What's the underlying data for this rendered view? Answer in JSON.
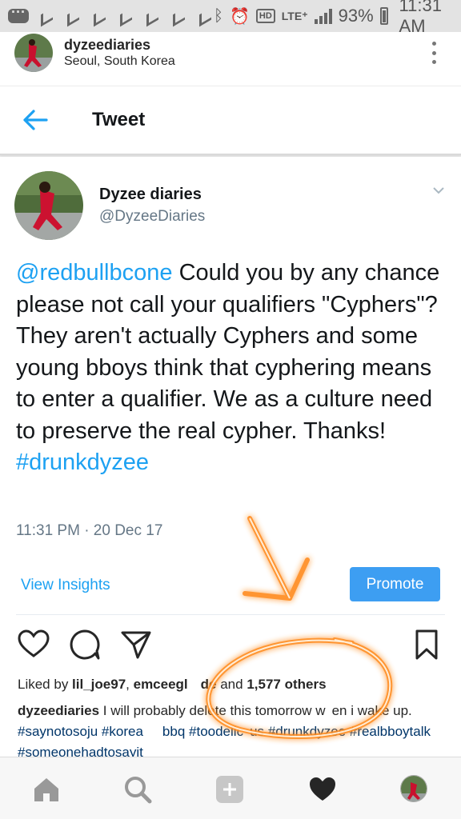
{
  "status_bar": {
    "battery": "93%",
    "time": "11:31 AM",
    "network": "LTE⁺",
    "hd": "HD",
    "icons": [
      "message-icon",
      "notification-icon",
      "notification-icon",
      "notification-icon",
      "notification-icon",
      "notification-icon",
      "notification-icon",
      "notification-icon",
      "bluetooth-icon",
      "alarm-icon",
      "hd-icon",
      "lte-icon",
      "signal-icon",
      "battery-icon"
    ]
  },
  "post_header": {
    "username": "dyzeediaries",
    "location": "Seoul, South Korea"
  },
  "tweet": {
    "screen_title": "Tweet",
    "display_name": "Dyzee diaries",
    "handle": "@DyzeeDiaries",
    "mention": "@redbullbcone",
    "body": " Could you by any chance please not call your qualifiers \"Cyphers\"? They aren't actually Cyphers and some young bboys think that cyphering means to enter a qualifier. We as a culture need to preserve the real cypher. Thanks! ",
    "hashtag": "#drunkdyzee",
    "timestamp": "11:31 PM · 20 Dec 17",
    "insights_label": "View Insights",
    "promote_label": "Promote",
    "link_color": "#1da1f2"
  },
  "post": {
    "liked_by_prefix": "Liked by ",
    "liker1": "lil_joe97",
    "sep": ", ",
    "liker2": "emceegl",
    "liker2_end": "de",
    "and_text": " and ",
    "others": "1,577 others",
    "caption_user": "dyzeediaries",
    "caption_text1": " I will probably delete this tomorrow w",
    "caption_text2": "en i wake up. ",
    "tag1": "#saynotosoju",
    "tag2": "#korea",
    "tag2_end": "bbq",
    "tag3": "#toodelic",
    "tag3_end": "us",
    "tag4": "#drunkdyzee",
    "tag5": "#realbboytalk",
    "tag6": "#someonehadtosayit"
  },
  "overlay": {
    "doodle_color": "#ff8a1a"
  },
  "bottom_nav": [
    "home-icon",
    "search-icon",
    "add-icon",
    "heart-icon",
    "profile-avatar"
  ]
}
